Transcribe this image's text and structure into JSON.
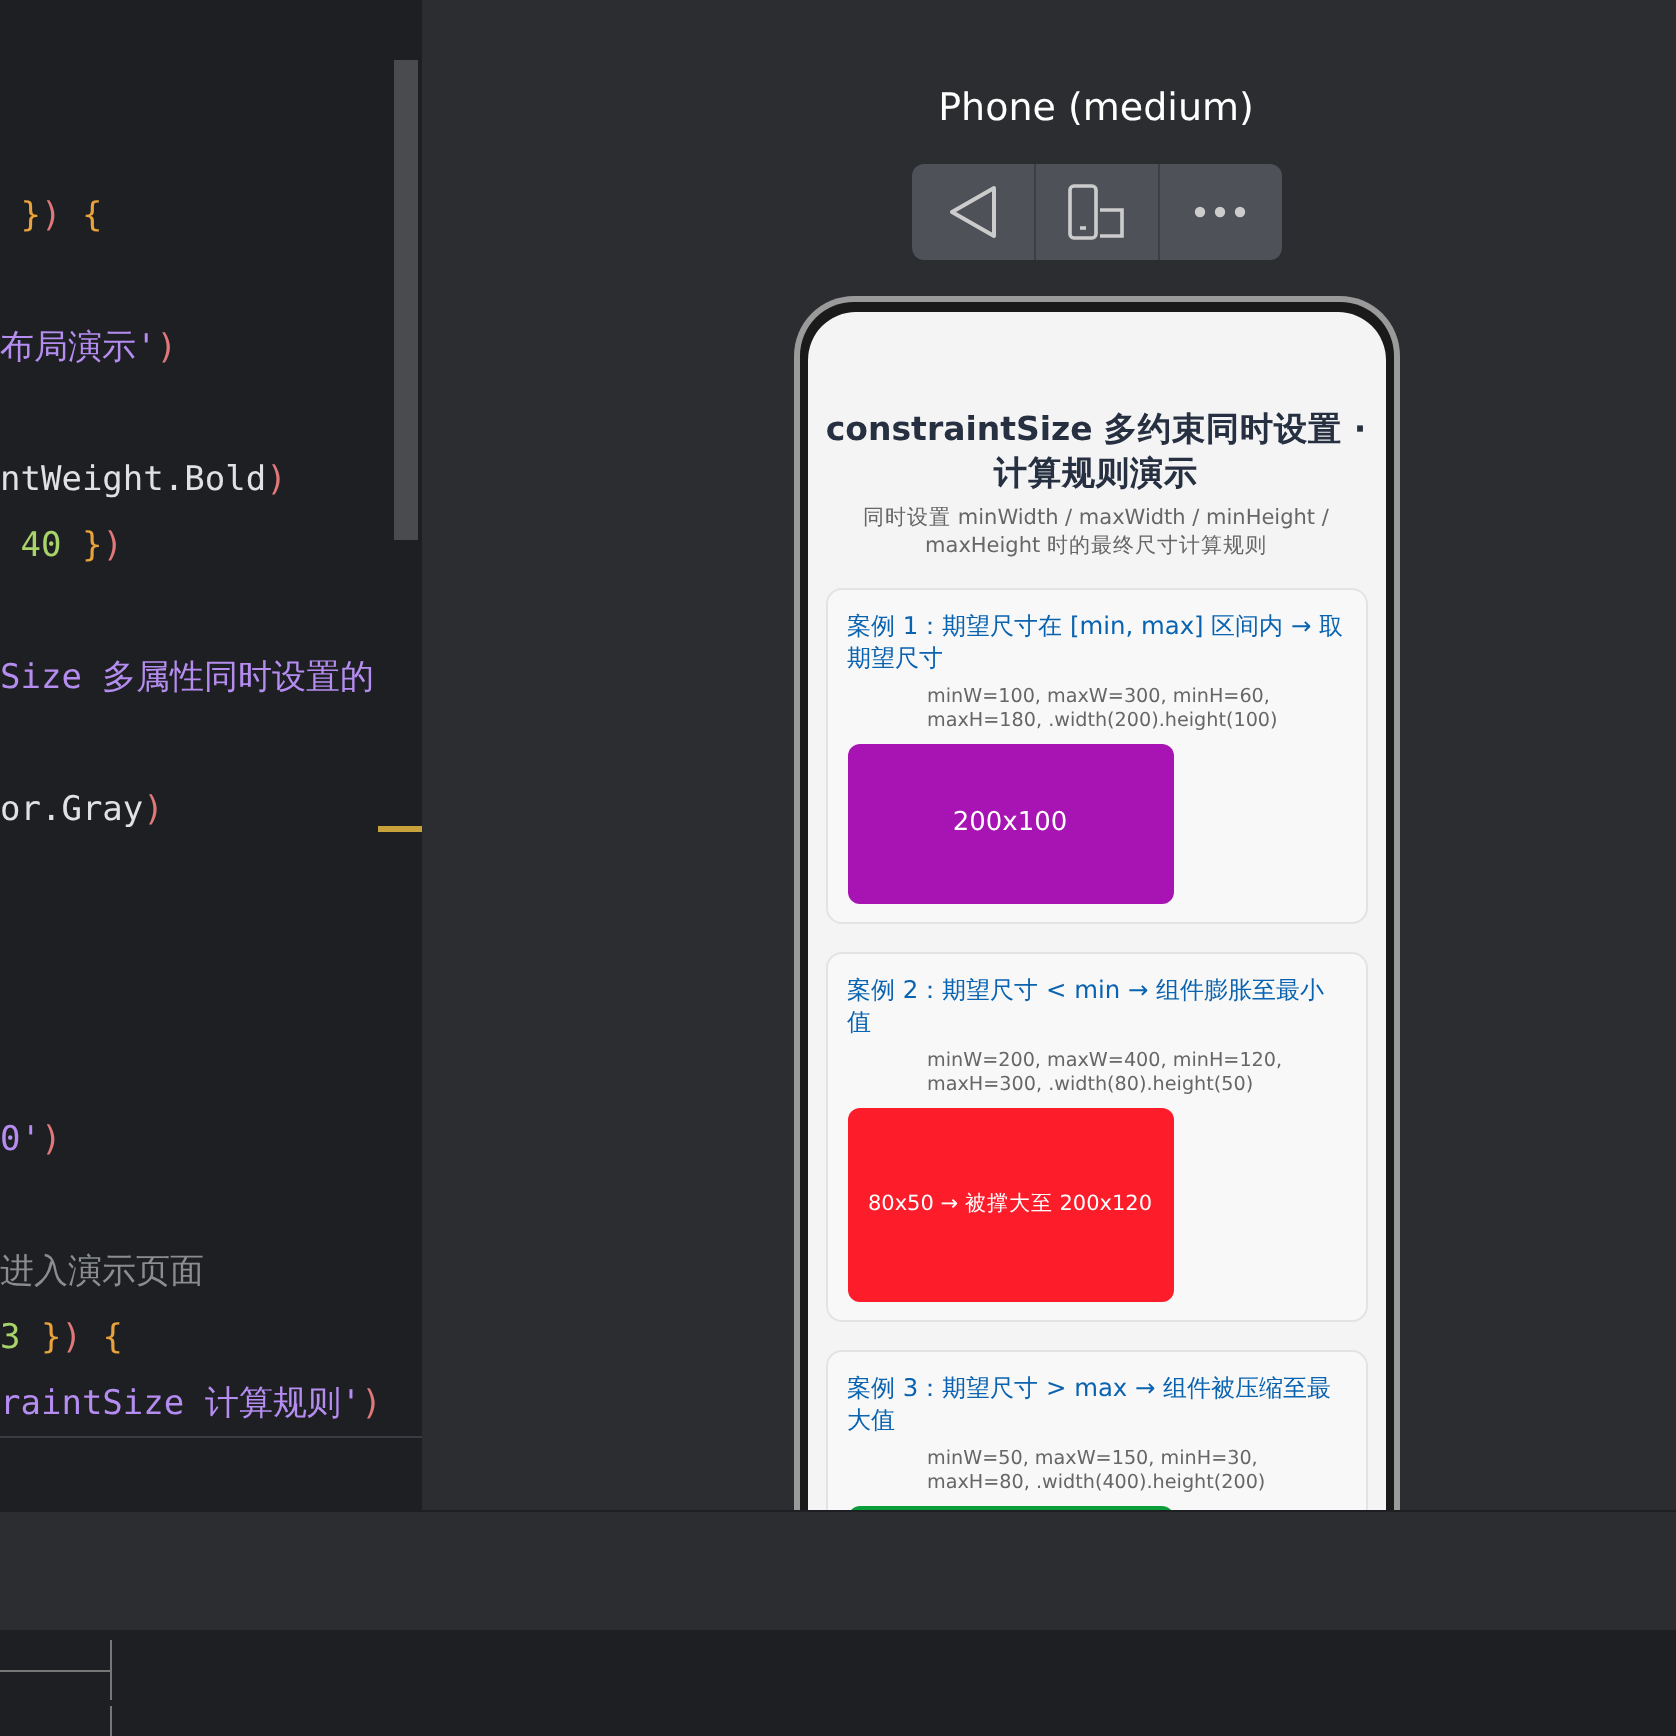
{
  "editor": {
    "lines": [
      {
        "segments": [
          {
            "kind": "brace",
            "text": " }"
          },
          {
            "kind": "paren",
            "text": ")"
          },
          {
            "kind": "brace",
            "text": " {"
          }
        ]
      },
      {
        "segments": [
          {
            "kind": "string",
            "text": "布局演示'"
          },
          {
            "kind": "paren",
            "text": ")"
          }
        ]
      },
      {
        "segments": [
          {
            "kind": "plain",
            "text": "ntWeight.Bold"
          },
          {
            "kind": "paren",
            "text": ")"
          }
        ]
      },
      {
        "segments": [
          {
            "kind": "number",
            "text": " 40"
          },
          {
            "kind": "brace",
            "text": " }"
          },
          {
            "kind": "paren",
            "text": ")"
          }
        ]
      },
      {
        "segments": [
          {
            "kind": "string",
            "text": "Size 多属性同时设置的"
          }
        ]
      },
      {
        "segments": [
          {
            "kind": "plain",
            "text": "or.Gray"
          },
          {
            "kind": "paren",
            "text": ")"
          }
        ]
      },
      {
        "segments": [
          {
            "kind": "string",
            "text": "0'"
          },
          {
            "kind": "paren",
            "text": ")"
          }
        ]
      },
      {
        "segments": [
          {
            "kind": "comment",
            "text": "进入演示页面"
          }
        ]
      },
      {
        "segments": [
          {
            "kind": "number",
            "text": "3"
          },
          {
            "kind": "brace",
            "text": " }"
          },
          {
            "kind": "paren",
            "text": ")"
          },
          {
            "kind": "brace",
            "text": " {"
          }
        ]
      },
      {
        "segments": [
          {
            "kind": "string",
            "text": "raintSize 计算规则'"
          },
          {
            "kind": "paren",
            "text": ")"
          }
        ]
      }
    ]
  },
  "preview": {
    "device": "Phone (medium)",
    "app": {
      "title": "constraintSize 多约束同时设置 · 计算规则演示",
      "subtitle": "同时设置 minWidth / maxWidth / minHeight / maxHeight 时的最终尺寸计算规则",
      "cases": [
        {
          "title": "案例 1：期望尺寸在 [min, max] 区间内 → 取期望尺寸",
          "params": "minW=100, maxW=300, minH=60, maxH=180, .width(200).height(100)",
          "box_label": "200x100",
          "color": "#a814b3"
        },
        {
          "title": "案例 2：期望尺寸 < min → 组件膨胀至最小值",
          "params": "minW=200, maxW=400, minH=120, maxH=300, .width(80).height(50)",
          "box_label": "80x50 → 被撑大至 200x120",
          "color": "#fc1c2a"
        },
        {
          "title": "案例 3：期望尺寸 > max → 组件被压缩至最大值",
          "params": "minW=50, maxW=150, minH=30, maxH=80, .width(400).height(200)",
          "color": "#0a9e3a"
        }
      ]
    }
  }
}
